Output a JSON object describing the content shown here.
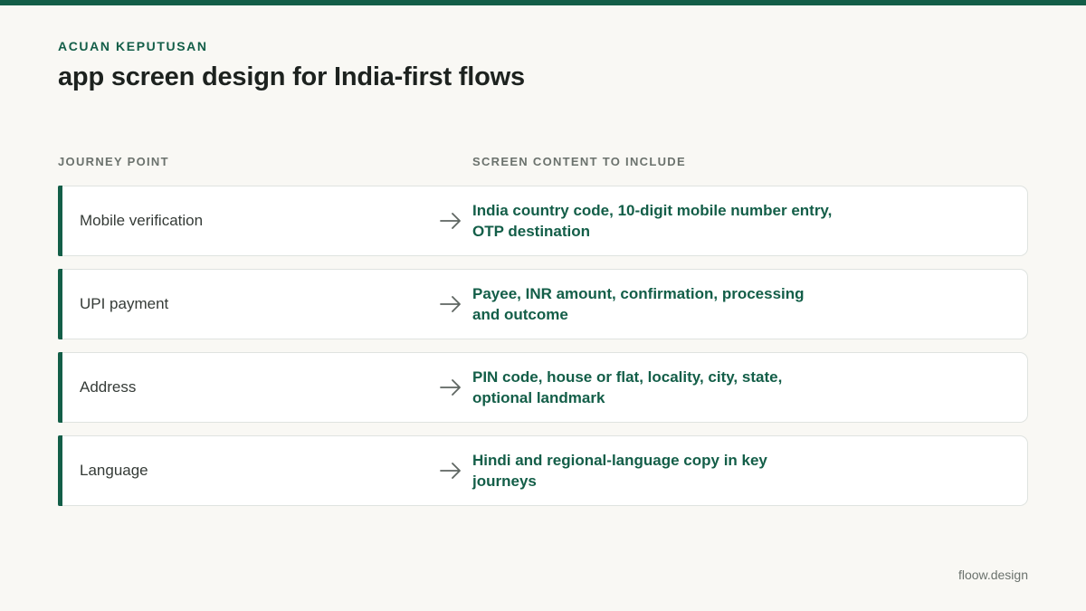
{
  "eyebrow": "ACUAN KEPUTUSAN",
  "title": "app screen design for India-first flows",
  "columns": {
    "left": "JOURNEY POINT",
    "right": "SCREEN CONTENT TO INCLUDE"
  },
  "rows": [
    {
      "label": "Mobile verification",
      "content": "India country code, 10-digit mobile number entry, OTP destination"
    },
    {
      "label": "UPI payment",
      "content": "Payee, INR amount, confirmation, processing and outcome"
    },
    {
      "label": "Address",
      "content": "PIN code, house or flat, locality, city, state, optional landmark"
    },
    {
      "label": "Language",
      "content": "Hindi and regional-language copy in key journeys"
    }
  ],
  "footer": "floow.design",
  "colors": {
    "accent": "#135e48",
    "background": "#f9f8f4"
  },
  "icons": {
    "row_arrow": "arrow-right-icon"
  }
}
